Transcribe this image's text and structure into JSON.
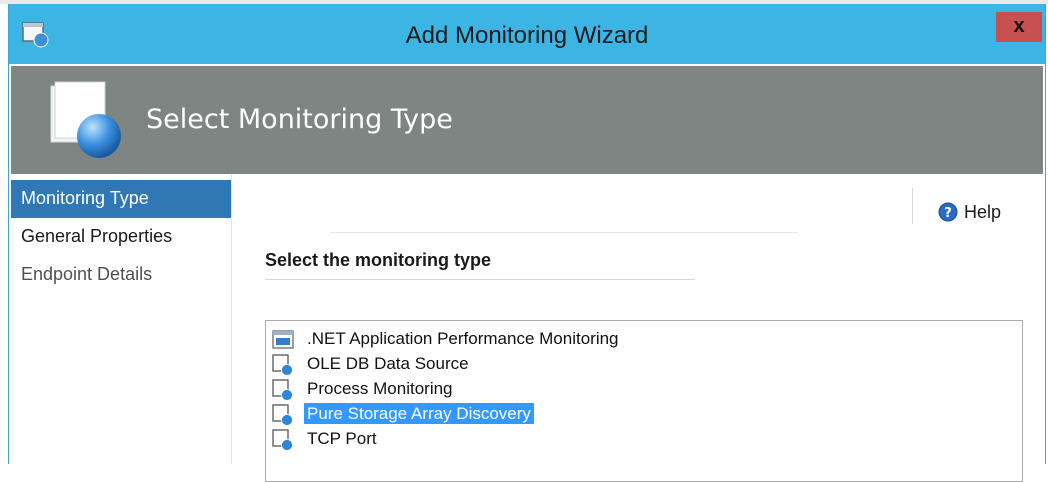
{
  "window": {
    "title": "Add Monitoring Wizard",
    "close_label": "x"
  },
  "header": {
    "page_title": "Select Monitoring Type"
  },
  "nav": {
    "items": [
      {
        "label": "Monitoring Type",
        "state": "active"
      },
      {
        "label": "General Properties",
        "state": "normal"
      },
      {
        "label": "Endpoint Details",
        "state": "disabled"
      }
    ]
  },
  "content": {
    "help_label": "Help",
    "section_title": "Select the monitoring type",
    "types": [
      {
        "label": ".NET Application Performance Monitoring",
        "icon": "dotnet-app-icon",
        "selected": false
      },
      {
        "label": "OLE DB Data Source",
        "icon": "monitor-template-icon",
        "selected": false
      },
      {
        "label": "Process Monitoring",
        "icon": "monitor-template-icon",
        "selected": false
      },
      {
        "label": "Pure Storage Array Discovery",
        "icon": "monitor-template-icon",
        "selected": true
      },
      {
        "label": "TCP Port",
        "icon": "monitor-template-icon",
        "selected": false
      }
    ]
  },
  "colors": {
    "titlebar": "#3cb4e4",
    "banner": "#7f8583",
    "nav_selected": "#2f78b5",
    "list_selected": "#3399ff",
    "close_button": "#c75050"
  }
}
